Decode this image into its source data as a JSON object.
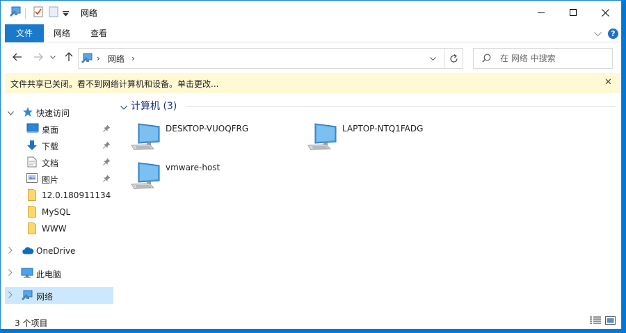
{
  "window": {
    "title": "网络"
  },
  "ribbon": {
    "tabs": [
      {
        "label": "文件"
      },
      {
        "label": "网络"
      },
      {
        "label": "查看"
      }
    ],
    "help_label": "?"
  },
  "address": {
    "path": "网络",
    "separator": "›"
  },
  "search": {
    "placeholder": "在 网络 中搜索"
  },
  "infobar": {
    "message": "文件共享已关闭。看不到网络计算机和设备。单击更改...",
    "close_label": "✕"
  },
  "navpane": {
    "items": [
      {
        "label": "快速访问",
        "icon": "star-icon"
      },
      {
        "label": "桌面",
        "icon": "desktop-folder-icon",
        "pinned": true
      },
      {
        "label": "下载",
        "icon": "download-arrow-icon",
        "pinned": true
      },
      {
        "label": "文档",
        "icon": "document-icon",
        "pinned": true
      },
      {
        "label": "图片",
        "icon": "picture-icon",
        "pinned": true
      },
      {
        "label": "12.0.180911134",
        "icon": "folder-icon"
      },
      {
        "label": "MySQL",
        "icon": "folder-icon"
      },
      {
        "label": "WWW",
        "icon": "folder-icon"
      },
      {
        "label": "OneDrive",
        "icon": "cloud-icon"
      },
      {
        "label": "此电脑",
        "icon": "computer-icon"
      },
      {
        "label": "网络",
        "icon": "network-icon",
        "selected": true
      }
    ]
  },
  "content": {
    "group_label": "计算机 (3)",
    "items": [
      {
        "name": "DESKTOP-VUOQFRG",
        "icon": "network-computer-icon"
      },
      {
        "name": "LAPTOP-NTQ1FADG",
        "icon": "network-computer-icon"
      },
      {
        "name": "vmware-host",
        "icon": "network-computer-icon"
      }
    ]
  },
  "status": {
    "count_text": "3 个项目"
  },
  "colors": {
    "accent": "#0078d7",
    "file_tab": "#1979ca",
    "selection": "#cce8ff",
    "infobar": "#fff9d4",
    "group_header": "#1e3287"
  }
}
